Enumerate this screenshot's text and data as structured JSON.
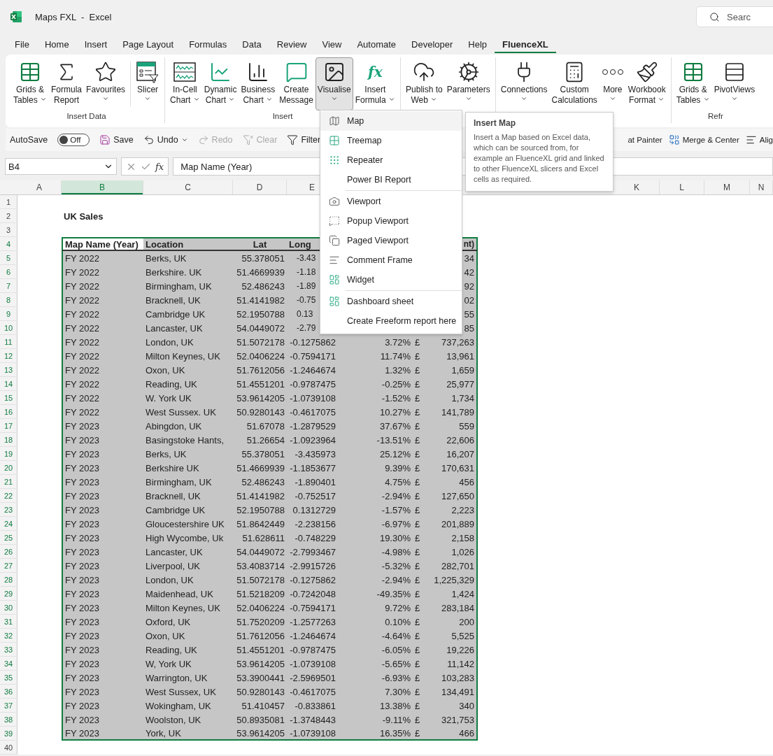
{
  "window": {
    "title": "Maps FXL  -  Excel",
    "search_placeholder": "Searc"
  },
  "menu_tabs": [
    {
      "label": "File",
      "selected": false
    },
    {
      "label": "Home",
      "selected": false
    },
    {
      "label": "Insert",
      "selected": false
    },
    {
      "label": "Page Layout",
      "selected": false
    },
    {
      "label": "Formulas",
      "selected": false
    },
    {
      "label": "Data",
      "selected": false
    },
    {
      "label": "Review",
      "selected": false
    },
    {
      "label": "View",
      "selected": false
    },
    {
      "label": "Automate",
      "selected": false
    },
    {
      "label": "Developer",
      "selected": false
    },
    {
      "label": "Help",
      "selected": false
    },
    {
      "label": "FluenceXL",
      "selected": true
    }
  ],
  "ribbon": {
    "groups": [
      {
        "label": "Insert Data",
        "buttons": [
          {
            "lines": [
              "Grids &",
              "Tables"
            ],
            "kind": "inline",
            "pressed": false
          },
          {
            "lines": [
              "Formula",
              "Report"
            ],
            "kind": "plain",
            "pressed": false
          },
          {
            "lines": [
              "Favourites"
            ],
            "kind": "below",
            "pressed": false
          },
          {
            "lines": [
              "Slicer"
            ],
            "kind": "below",
            "pressed": false,
            "separator_before": true
          }
        ]
      },
      {
        "label": "Insert",
        "buttons": [
          {
            "lines": [
              "In-Cell",
              "Chart"
            ],
            "kind": "inline",
            "pressed": false
          },
          {
            "lines": [
              "Dynamic",
              "Chart"
            ],
            "kind": "inline",
            "pressed": false
          },
          {
            "lines": [
              "Business",
              "Chart"
            ],
            "kind": "inline",
            "pressed": false
          },
          {
            "lines": [
              "Create",
              "Message"
            ],
            "kind": "plain",
            "pressed": false
          },
          {
            "lines": [
              "Visualise"
            ],
            "kind": "below",
            "pressed": true
          },
          {
            "lines": [
              "Insert",
              "Formula"
            ],
            "kind": "inline",
            "pressed": false,
            "glyph": "fx"
          }
        ]
      },
      {
        "buttons": [
          {
            "lines": [
              "Publish to",
              "Web"
            ],
            "kind": "inline",
            "pressed": false
          },
          {
            "lines": [
              "Parameters"
            ],
            "kind": "below",
            "pressed": false
          }
        ]
      },
      {
        "buttons": [
          {
            "lines": [
              "Connections"
            ],
            "kind": "below",
            "pressed": false
          },
          {
            "lines": [
              "Custom",
              "Calculations"
            ],
            "kind": "plain",
            "pressed": false
          },
          {
            "lines": [
              "More"
            ],
            "kind": "below",
            "pressed": false
          },
          {
            "lines": [
              "Workbook",
              "Format"
            ],
            "kind": "inline",
            "pressed": false
          }
        ]
      },
      {
        "label": "Refr",
        "buttons": [
          {
            "lines": [
              "Grids &",
              "Tables"
            ],
            "kind": "inline",
            "pressed": false
          },
          {
            "lines": [
              "PivotViews"
            ],
            "kind": "below",
            "pressed": false
          }
        ]
      }
    ]
  },
  "quick_toolbar": {
    "autosave": {
      "label": "AutoSave",
      "on": false,
      "state_text": "Off"
    },
    "items": [
      {
        "label": "Save",
        "disabled": false,
        "caret": false
      },
      {
        "label": "Undo",
        "disabled": false,
        "caret": true
      },
      {
        "label": "Redo",
        "disabled": true,
        "caret": false
      },
      {
        "label": "Clear",
        "disabled": true,
        "caret": false
      },
      {
        "label": "Filter",
        "disabled": false,
        "caret": false
      }
    ],
    "right_items": [
      {
        "label": "at Painter"
      },
      {
        "label": "Merge & Center"
      },
      {
        "label": "Alig"
      }
    ]
  },
  "formula_bar": {
    "name_box": "B4",
    "fx": "fx",
    "value": "Map Name (Year)"
  },
  "sheet": {
    "columns_left": [
      {
        "label": "A",
        "selected": false
      },
      {
        "label": "B",
        "selected": true
      },
      {
        "label": "C",
        "selected": false
      },
      {
        "label": "D",
        "selected": false
      },
      {
        "label": "E",
        "selected": false
      }
    ],
    "columns_right": [
      {
        "label": "K",
        "selected": false
      },
      {
        "label": "L",
        "selected": false
      },
      {
        "label": "M",
        "selected": false
      },
      {
        "label": "N",
        "selected": false
      }
    ],
    "title": "UK Sales",
    "header": {
      "year": "Map Name (Year)",
      "location": "Location",
      "lat": "Lat",
      "long": "Long",
      "amount": "nt)"
    },
    "rows": [
      {
        "year": "FY 2022",
        "location": "Berks, UK",
        "lat": "55.378051",
        "long": "-3.43",
        "amount": "34",
        "cut": true
      },
      {
        "year": "FY 2022",
        "location": "Berkshire. UK",
        "lat": "51.4669939",
        "long": "-1.18",
        "amount": "42",
        "cut": true
      },
      {
        "year": "FY 2022",
        "location": "Birmingham, UK",
        "lat": "52.486243",
        "long": "-1.89",
        "amount": "92",
        "cut": true
      },
      {
        "year": "FY 2022",
        "location": "Bracknell, UK",
        "lat": "51.4141982",
        "long": "-0.75",
        "amount": "02",
        "cut": true
      },
      {
        "year": "FY 2022",
        "location": "Cambridge UK",
        "lat": "52.1950788",
        "long": "0.13",
        "amount": "55",
        "cut": true
      },
      {
        "year": "FY 2022",
        "location": "Lancaster, UK",
        "lat": "54.0449072",
        "long": "-2.79",
        "amount": "85",
        "cut": true
      },
      {
        "year": "FY 2022",
        "location": "London, UK",
        "lat": "51.5072178",
        "long": "-0.1275862",
        "change": "3.72%",
        "currency": "£",
        "amount": "737,263",
        "cut": false
      },
      {
        "year": "FY 2022",
        "location": "Milton Keynes, UK",
        "lat": "52.0406224",
        "long": "-0.7594171",
        "change": "11.74%",
        "currency": "£",
        "amount": "13,961",
        "cut": false
      },
      {
        "year": "FY 2022",
        "location": "Oxon, UK",
        "lat": "51.7612056",
        "long": "-1.2464674",
        "change": "1.32%",
        "currency": "£",
        "amount": "1,659",
        "cut": false
      },
      {
        "year": "FY 2022",
        "location": "Reading, UK",
        "lat": "51.4551201",
        "long": "-0.9787475",
        "change": "-0.25%",
        "currency": "£",
        "amount": "25,977",
        "cut": false
      },
      {
        "year": "FY 2022",
        "location": "W. York UK",
        "lat": "53.9614205",
        "long": "-1.0739108",
        "change": "-1.52%",
        "currency": "£",
        "amount": "1,734",
        "cut": false
      },
      {
        "year": "FY 2022",
        "location": "West Sussex. UK",
        "lat": "50.9280143",
        "long": "-0.4617075",
        "change": "10.27%",
        "currency": "£",
        "amount": "141,789",
        "cut": false
      },
      {
        "year": "FY 2023",
        "location": "Abingdon, UK",
        "lat": "51.67078",
        "long": "-1.2879529",
        "change": "37.67%",
        "currency": "£",
        "amount": "559",
        "cut": false
      },
      {
        "year": "FY 2023",
        "location": "Basingstoke Hants,",
        "lat": "51.26654",
        "long": "-1.0923964",
        "change": "-13.51%",
        "currency": "£",
        "amount": "22,606",
        "cut": false
      },
      {
        "year": "FY 2023",
        "location": "Berks, UK",
        "lat": "55.378051",
        "long": "-3.435973",
        "change": "25.12%",
        "currency": "£",
        "amount": "16,207",
        "cut": false
      },
      {
        "year": "FY 2023",
        "location": "Berkshire UK",
        "lat": "51.4669939",
        "long": "-1.1853677",
        "change": "9.39%",
        "currency": "£",
        "amount": "170,631",
        "cut": false
      },
      {
        "year": "FY 2023",
        "location": "Birmingham, UK",
        "lat": "52.486243",
        "long": "-1.890401",
        "change": "4.75%",
        "currency": "£",
        "amount": "456",
        "cut": false
      },
      {
        "year": "FY 2023",
        "location": "Bracknell, UK",
        "lat": "51.4141982",
        "long": "-0.752517",
        "change": "-2.94%",
        "currency": "£",
        "amount": "127,650",
        "cut": false
      },
      {
        "year": "FY 2023",
        "location": "Cambridge UK",
        "lat": "52.1950788",
        "long": "0.1312729",
        "change": "-1.57%",
        "currency": "£",
        "amount": "2,223",
        "cut": false
      },
      {
        "year": "FY 2023",
        "location": "Gloucestershire UK",
        "lat": "51.8642449",
        "long": "-2.238156",
        "change": "-6.97%",
        "currency": "£",
        "amount": "201,889",
        "cut": false
      },
      {
        "year": "FY 2023",
        "location": "High Wycombe, Uk",
        "lat": "51.628611",
        "long": "-0.748229",
        "change": "19.30%",
        "currency": "£",
        "amount": "2,158",
        "cut": false
      },
      {
        "year": "FY 2023",
        "location": "Lancaster, UK",
        "lat": "54.0449072",
        "long": "-2.7993467",
        "change": "-4.98%",
        "currency": "£",
        "amount": "1,026",
        "cut": false
      },
      {
        "year": "FY 2023",
        "location": "Liverpool, UK",
        "lat": "53.4083714",
        "long": "-2.9915726",
        "change": "-5.32%",
        "currency": "£",
        "amount": "282,701",
        "cut": false
      },
      {
        "year": "FY 2023",
        "location": "London, UK",
        "lat": "51.5072178",
        "long": "-0.1275862",
        "change": "-2.94%",
        "currency": "£",
        "amount": "1,225,329",
        "cut": false
      },
      {
        "year": "FY 2023",
        "location": "Maidenhead, UK",
        "lat": "51.5218209",
        "long": "-0.7242048",
        "change": "-49.35%",
        "currency": "£",
        "amount": "1,424",
        "cut": false
      },
      {
        "year": "FY 2023",
        "location": "Milton Keynes, UK",
        "lat": "52.0406224",
        "long": "-0.7594171",
        "change": "9.72%",
        "currency": "£",
        "amount": "283,184",
        "cut": false
      },
      {
        "year": "FY 2023",
        "location": "Oxford, UK",
        "lat": "51.7520209",
        "long": "-1.2577263",
        "change": "0.10%",
        "currency": "£",
        "amount": "200",
        "cut": false
      },
      {
        "year": "FY 2023",
        "location": "Oxon, UK",
        "lat": "51.7612056",
        "long": "-1.2464674",
        "change": "-4.64%",
        "currency": "£",
        "amount": "5,525",
        "cut": false
      },
      {
        "year": "FY 2023",
        "location": "Reading, UK",
        "lat": "51.4551201",
        "long": "-0.9787475",
        "change": "-6.05%",
        "currency": "£",
        "amount": "19,226",
        "cut": false
      },
      {
        "year": "FY 2023",
        "location": "W, York UK",
        "lat": "53.9614205",
        "long": "-1.0739108",
        "change": "-5.65%",
        "currency": "£",
        "amount": "11,142",
        "cut": false
      },
      {
        "year": "FY 2023",
        "location": "Warrington, UK",
        "lat": "53.3900441",
        "long": "-2.5969501",
        "change": "-6.93%",
        "currency": "£",
        "amount": "103,283",
        "cut": false
      },
      {
        "year": "FY 2023",
        "location": "West Sussex, UK",
        "lat": "50.9280143",
        "long": "-0.4617075",
        "change": "7.30%",
        "currency": "£",
        "amount": "134,491",
        "cut": false
      },
      {
        "year": "FY 2023",
        "location": "Wokingham, UK",
        "lat": "51.410457",
        "long": "-0.833861",
        "change": "13.38%",
        "currency": "£",
        "amount": "340",
        "cut": false
      },
      {
        "year": "FY 2023",
        "location": "Woolston, UK",
        "lat": "50.8935081",
        "long": "-1.3748443",
        "change": "-9.11%",
        "currency": "£",
        "amount": "321,753",
        "cut": false
      },
      {
        "year": "FY 2023",
        "location": "York, UK",
        "lat": "53.9614205",
        "long": "-1.0739108",
        "change": "16.35%",
        "currency": "£",
        "amount": "466",
        "cut": false
      }
    ],
    "row_numbers": [
      {
        "label": "1",
        "selected": false
      },
      {
        "label": "2",
        "selected": false
      },
      {
        "label": "3",
        "selected": false
      },
      {
        "label": "4",
        "selected": true
      },
      {
        "label": "5",
        "selected": true
      },
      {
        "label": "6",
        "selected": true
      },
      {
        "label": "7",
        "selected": true
      },
      {
        "label": "8",
        "selected": true
      },
      {
        "label": "9",
        "selected": true
      },
      {
        "label": "10",
        "selected": true
      },
      {
        "label": "11",
        "selected": true
      },
      {
        "label": "12",
        "selected": true
      },
      {
        "label": "13",
        "selected": true
      },
      {
        "label": "14",
        "selected": true
      },
      {
        "label": "15",
        "selected": true
      },
      {
        "label": "16",
        "selected": true
      },
      {
        "label": "17",
        "selected": true
      },
      {
        "label": "18",
        "selected": true
      },
      {
        "label": "19",
        "selected": true
      },
      {
        "label": "20",
        "selected": true
      },
      {
        "label": "21",
        "selected": true
      },
      {
        "label": "22",
        "selected": true
      },
      {
        "label": "23",
        "selected": true
      },
      {
        "label": "24",
        "selected": true
      },
      {
        "label": "25",
        "selected": true
      },
      {
        "label": "26",
        "selected": true
      },
      {
        "label": "27",
        "selected": true
      },
      {
        "label": "28",
        "selected": true
      },
      {
        "label": "29",
        "selected": true
      },
      {
        "label": "30",
        "selected": true
      },
      {
        "label": "31",
        "selected": true
      },
      {
        "label": "32",
        "selected": true
      },
      {
        "label": "33",
        "selected": true
      },
      {
        "label": "34",
        "selected": true
      },
      {
        "label": "35",
        "selected": true
      },
      {
        "label": "36",
        "selected": true
      },
      {
        "label": "37",
        "selected": true
      },
      {
        "label": "38",
        "selected": true
      },
      {
        "label": "39",
        "selected": true
      },
      {
        "label": "40",
        "selected": false
      }
    ]
  },
  "dropdown": {
    "sections": [
      [
        {
          "label": "Map",
          "selected": true
        },
        {
          "label": "Treemap",
          "selected": false
        },
        {
          "label": "Repeater",
          "selected": false
        },
        {
          "label": "Power BI Report",
          "selected": false
        }
      ],
      [
        {
          "label": "Viewport",
          "selected": false
        },
        {
          "label": "Popup Viewport",
          "selected": false
        },
        {
          "label": "Paged Viewport",
          "selected": false
        },
        {
          "label": "Comment Frame",
          "selected": false
        },
        {
          "label": "Widget",
          "selected": false
        }
      ],
      [
        {
          "label": "Dashboard sheet",
          "selected": false
        },
        {
          "label": "Create Freeform report here",
          "selected": false
        }
      ]
    ]
  },
  "tooltip": {
    "title": "Insert Map",
    "body": "Insert a Map based on Excel data, which can be sourced from, for example an FluenceXL grid and linked to other FluenceXL slicers and Excel cells as required."
  }
}
